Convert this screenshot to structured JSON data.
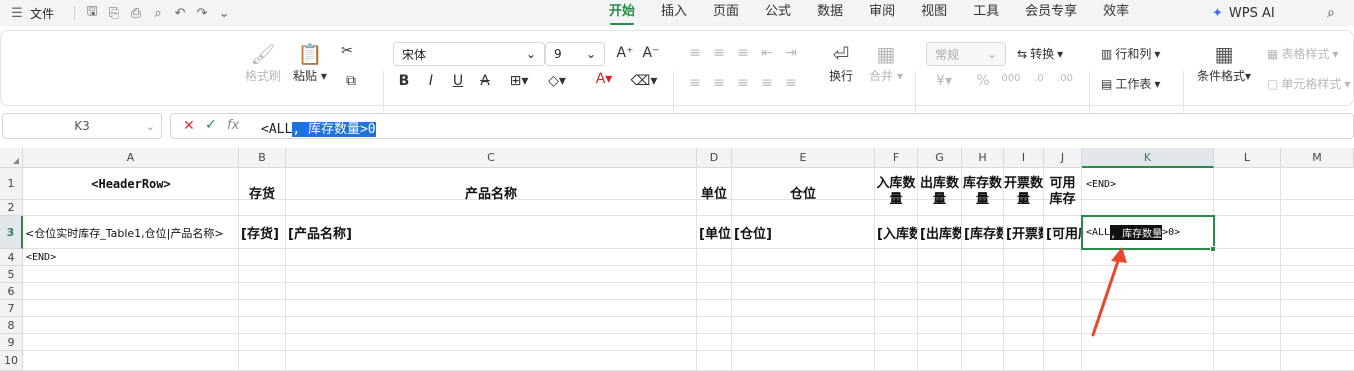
{
  "menubar": {
    "file_label": "文件",
    "tabs": [
      "开始",
      "插入",
      "页面",
      "公式",
      "数据",
      "审阅",
      "视图",
      "工具",
      "会员专享",
      "效率"
    ],
    "active_tab": "开始",
    "wps_ai_label": "WPS AI"
  },
  "ribbon": {
    "format_painter": "格式刷",
    "paste": "粘贴",
    "font_name": "宋体",
    "font_size": "9",
    "number_format": "常规",
    "convert": "转换",
    "rows_cols": "行和列",
    "wrap": "换行",
    "merge": "合并",
    "worksheet": "工作表",
    "conditional_format": "条件格式",
    "table_style": "表格样式",
    "cell_style": "单元格样式"
  },
  "formula_bar": {
    "name_box": "K3",
    "fx": "fx",
    "content_before": "<ALL",
    "content_selected": ", 库存数量>0"
  },
  "columns": [
    {
      "label": "A"
    },
    {
      "label": "B"
    },
    {
      "label": "C"
    },
    {
      "label": "D"
    },
    {
      "label": "E"
    },
    {
      "label": "F"
    },
    {
      "label": "G"
    },
    {
      "label": "H"
    },
    {
      "label": "I"
    },
    {
      "label": "J"
    },
    {
      "label": "K"
    },
    {
      "label": "L"
    },
    {
      "label": "M"
    }
  ],
  "rows": [
    "1",
    "2",
    "3",
    "4",
    "5",
    "6",
    "7",
    "8",
    "9",
    "10"
  ],
  "cells": {
    "A1": "<HeaderRow>",
    "B1": "存货",
    "C1": "产品名称",
    "D1": "单位",
    "E1": "仓位",
    "F1": "入库数量",
    "G1": "出库数量",
    "H1": "库存数量",
    "I1": "开票数量",
    "J1": "可用库存",
    "K1": "<END>",
    "A3": "<仓位实时库存_Table1,仓位|产品名称>",
    "B3": "[存货]",
    "C3": "[产品名称]",
    "D3": "[单位]",
    "E3": "[仓位]",
    "F3": "[入库数量]",
    "G3": "[出库数量]",
    "H3": "[库存数量]",
    "I3": "[开票数量]",
    "J3": "[可用库存]",
    "K3_before": "<ALL",
    "K3_selected": ", 库存数量",
    "K3_after": ">0>",
    "A4": "<END>"
  },
  "accent_color": "#2a8a4a",
  "selection_color": "#1e73d8",
  "arrow_color": "#e8492d"
}
